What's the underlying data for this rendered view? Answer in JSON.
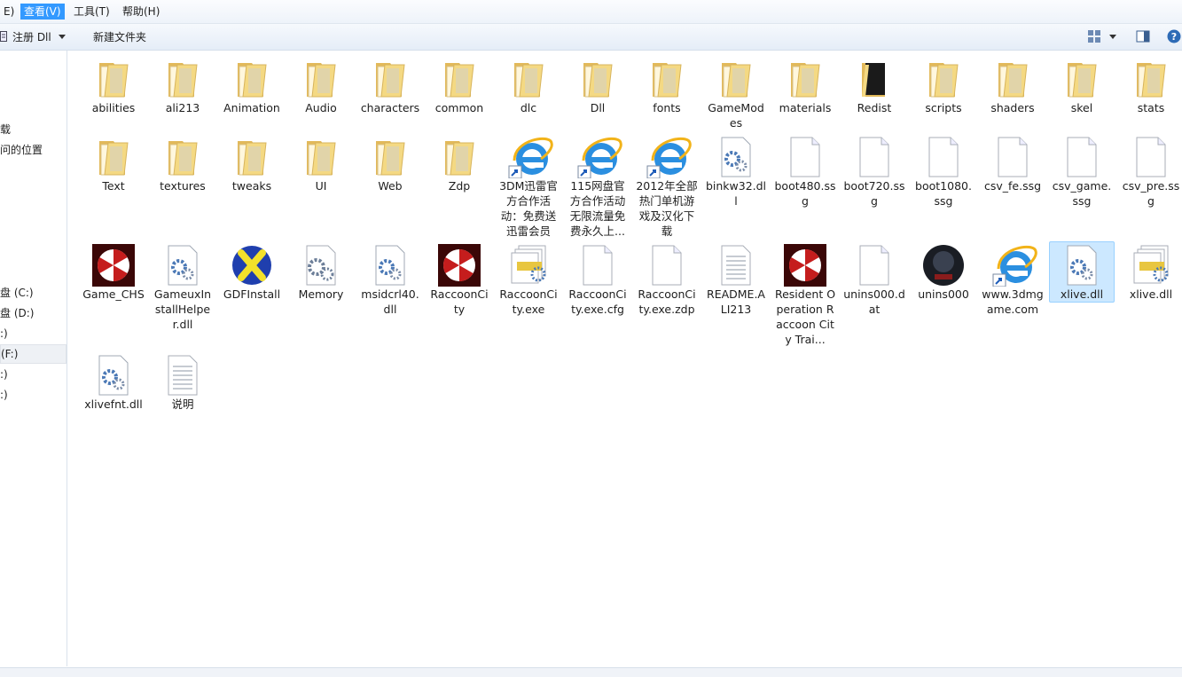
{
  "menubar": {
    "items": [
      "E)",
      "查看(V)",
      "工具(T)",
      "帮助(H)"
    ]
  },
  "toolbar": {
    "register": "注册 Dll",
    "newfolder": "新建文件夹"
  },
  "nav": {
    "items": [
      "载",
      "问的位置",
      "盘 (C:)",
      "盘 (D:)",
      ":)",
      "(F:)",
      ":)",
      ":)"
    ]
  },
  "files": [
    {
      "name": "abilities",
      "type": "folder"
    },
    {
      "name": "ali213",
      "type": "folder"
    },
    {
      "name": "Animation",
      "type": "folder"
    },
    {
      "name": "Audio",
      "type": "folder"
    },
    {
      "name": "characters",
      "type": "folder"
    },
    {
      "name": "common",
      "type": "folder"
    },
    {
      "name": "dlc",
      "type": "folder"
    },
    {
      "name": "Dll",
      "type": "folder"
    },
    {
      "name": "fonts",
      "type": "folder"
    },
    {
      "name": "GameModes",
      "type": "folder"
    },
    {
      "name": "materials",
      "type": "folder"
    },
    {
      "name": "Redist",
      "type": "folder-dark"
    },
    {
      "name": "scripts",
      "type": "folder"
    },
    {
      "name": "shaders",
      "type": "folder"
    },
    {
      "name": "skel",
      "type": "folder"
    },
    {
      "name": "stats",
      "type": "folder"
    },
    {
      "name": "Text",
      "type": "folder"
    },
    {
      "name": "textures",
      "type": "folder"
    },
    {
      "name": "tweaks",
      "type": "folder"
    },
    {
      "name": "UI",
      "type": "folder"
    },
    {
      "name": "Web",
      "type": "folder"
    },
    {
      "name": "Zdp",
      "type": "folder"
    },
    {
      "name": "3DM迅雷官方合作活动：免费送迅雷会员",
      "type": "ie"
    },
    {
      "name": "115网盘官方合作活动无限流量免费永久上...",
      "type": "ie"
    },
    {
      "name": "2012年全部热门单机游戏及汉化下载",
      "type": "ie"
    },
    {
      "name": "binkw32.dll",
      "type": "dll"
    },
    {
      "name": "boot480.ssg",
      "type": "blank"
    },
    {
      "name": "boot720.ssg",
      "type": "blank"
    },
    {
      "name": "boot1080.ssg",
      "type": "blank"
    },
    {
      "name": "csv_fe.ssg",
      "type": "blank"
    },
    {
      "name": "csv_game.ssg",
      "type": "blank"
    },
    {
      "name": "csv_pre.ssg",
      "type": "blank"
    },
    {
      "name": "Game_CHS",
      "type": "umbrella"
    },
    {
      "name": "GameuxInstallHelper.dll",
      "type": "dll"
    },
    {
      "name": "GDFInstall",
      "type": "gdf"
    },
    {
      "name": "Memory",
      "type": "gear"
    },
    {
      "name": "msidcrl40.dll",
      "type": "dll"
    },
    {
      "name": "RaccoonCity",
      "type": "umbrella"
    },
    {
      "name": "RaccoonCity.exe",
      "type": "exe"
    },
    {
      "name": "RaccoonCity.exe.cfg",
      "type": "blank"
    },
    {
      "name": "RaccoonCity.exe.zdp",
      "type": "blank"
    },
    {
      "name": "README.ALI213",
      "type": "text"
    },
    {
      "name": "Resident Operation Raccoon City Trai...",
      "type": "umbrella"
    },
    {
      "name": "unins000.dat",
      "type": "blank"
    },
    {
      "name": "unins000",
      "type": "dark"
    },
    {
      "name": "www.3dmgame.com",
      "type": "ie"
    },
    {
      "name": "xlive.dll",
      "type": "dll",
      "selected": true
    },
    {
      "name": "xlive.dll",
      "type": "exe"
    },
    {
      "name": "xlivefnt.dll",
      "type": "dll"
    },
    {
      "name": "说明",
      "type": "text"
    }
  ],
  "labels": {
    "f0": "abilities",
    "f1": "ali213",
    "f2": "Animation",
    "f3": "Audio",
    "f4": "characters",
    "f5": "common",
    "f6": "dlc",
    "f7": "Dll",
    "f8": "fonts",
    "f9": "GameModes",
    "f10": "materials",
    "f11": "Redist",
    "f12": "scripts",
    "f13": "shaders",
    "f14": "skel",
    "f15": "stats",
    "f16": "Text",
    "f17": "textures",
    "f18": "tweaks",
    "f19": "UI",
    "f20": "Web",
    "f21": "Zdp",
    "f22": "3DM迅雷官方合作活动：免费送迅雷会员",
    "f23": "115网盘官方合作活动无限流量免费永久上...",
    "f24": "2012年全部热门单机游戏及汉化下载",
    "f25": "binkw32.dll",
    "f26": "boot480.ssg",
    "f27": "boot720.ssg",
    "f28": "boot1080.ssg",
    "f29": "csv_fe.ssg",
    "f30": "csv_game.ssg",
    "f31": "csv_pre.ssg",
    "f32": "Game_CHS",
    "f33": "GameuxInstallHelper.dll",
    "f34": "GDFInstall",
    "f35": "Memory",
    "f36": "msidcrl40.dll",
    "f37": "RaccoonCity",
    "f38": "RaccoonCity.exe",
    "f39": "RaccoonCity.exe.cfg",
    "f40": "RaccoonCity.exe.zdp",
    "f41": "README.ALI213",
    "f42": "Resident Operation Raccoon City Trai...",
    "f43": "unins000.dat",
    "f44": "unins000",
    "f45": "www.3dmgame.com",
    "f46": "xlive.dll",
    "f47": "xlive.dll",
    "f48": "xlivefnt.dll",
    "f49": "说明"
  },
  "colors": {
    "selection_bg": "#cce8ff",
    "selection_border": "#99d1ff",
    "folder": "#f1d278",
    "menu_active": "#3399ff"
  }
}
